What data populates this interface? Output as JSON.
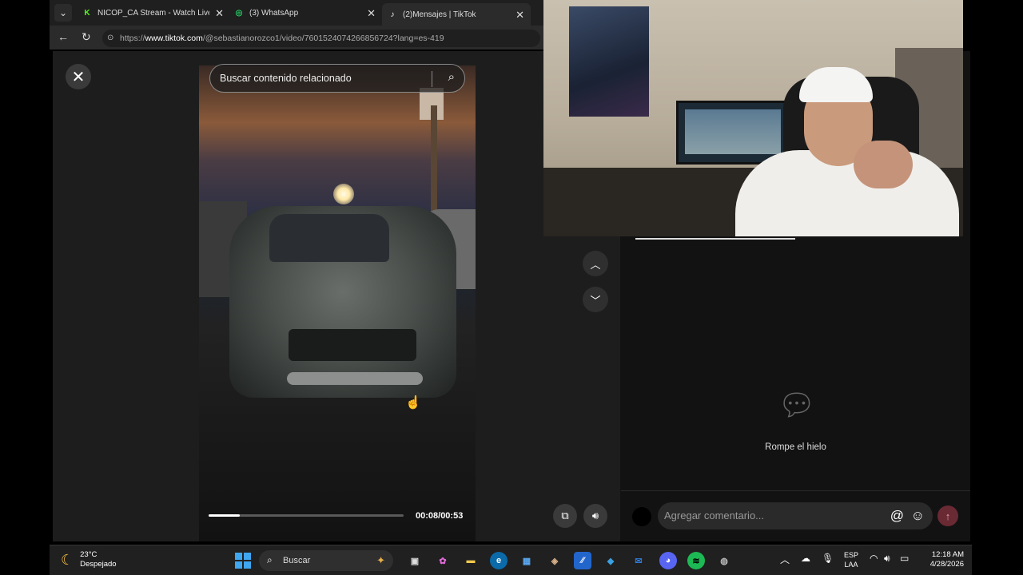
{
  "browser": {
    "tabs": [
      {
        "favicon": "kick-icon",
        "title": "NICOP_CA Stream - Watch Live on Kick",
        "color": "#53fc18"
      },
      {
        "favicon": "whatsapp-icon",
        "title": "(3) WhatsApp",
        "color": "#25d366"
      },
      {
        "favicon": "tiktok-icon",
        "title": "(2)Mensajes | TikTok",
        "color": "#ffffff"
      }
    ],
    "url_prefix": "https://",
    "url_host": "www.tiktok.com",
    "url_path": "/@sebastianorozco1/video/7601524074266856724?lang=es-419"
  },
  "video": {
    "search_placeholder": "Buscar contenido relacionado",
    "progress": 0.16,
    "time": "00:08/00:53"
  },
  "comments": {
    "empty_text": "Rompe el hielo",
    "placeholder": "Agregar comentario..."
  },
  "taskbar": {
    "temperature": "23°C",
    "condition": "Despejado",
    "search_label": "Buscar",
    "lang_top": "ESP",
    "lang_bottom": "LAA",
    "time": "12:18 AM",
    "date": "4/28/2026"
  }
}
